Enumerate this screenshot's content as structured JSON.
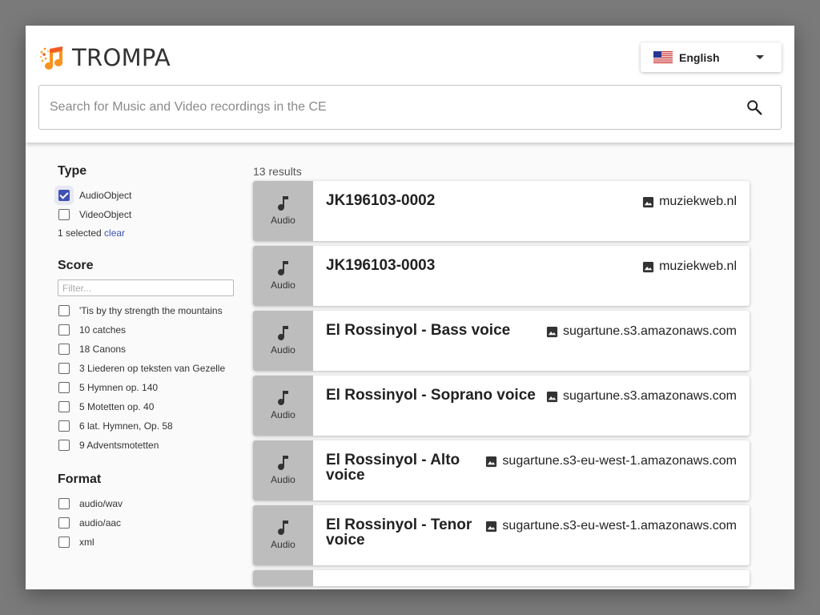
{
  "header": {
    "brand": "TROMPA",
    "language": {
      "label": "English",
      "flag_icon": "us-flag-icon"
    },
    "search": {
      "placeholder": "Search for Music and Video recordings in the CE",
      "value": ""
    }
  },
  "sidebar": {
    "type_facet": {
      "title": "Type",
      "items": [
        {
          "label": "AudioObject",
          "checked": true
        },
        {
          "label": "VideoObject",
          "checked": false
        }
      ],
      "selected_text": "1 selected",
      "clear_label": "clear"
    },
    "score_facet": {
      "title": "Score",
      "filter_placeholder": "Filter...",
      "items": [
        {
          "label": "'Tis by thy strength the mountains",
          "checked": false
        },
        {
          "label": "10 catches",
          "checked": false
        },
        {
          "label": "18 Canons",
          "checked": false
        },
        {
          "label": "3 Liederen op teksten van Gezelle",
          "checked": false
        },
        {
          "label": "5 Hymnen op. 140",
          "checked": false
        },
        {
          "label": "5 Motetten op. 40",
          "checked": false
        },
        {
          "label": "6 lat. Hymnen, Op. 58",
          "checked": false
        },
        {
          "label": "9 Adventsmotetten",
          "checked": false
        }
      ]
    },
    "format_facet": {
      "title": "Format",
      "items": [
        {
          "label": "audio/wav",
          "checked": false
        },
        {
          "label": "audio/aac",
          "checked": false
        },
        {
          "label": "xml",
          "checked": false
        }
      ]
    }
  },
  "results": {
    "count_text": "13 results",
    "items": [
      {
        "type_label": "Audio",
        "title": "JK196103-0002",
        "source": "muziekweb.nl"
      },
      {
        "type_label": "Audio",
        "title": "JK196103-0003",
        "source": "muziekweb.nl"
      },
      {
        "type_label": "Audio",
        "title": "El Rossinyol - Bass voice",
        "source": "sugartune.s3.amazonaws.com"
      },
      {
        "type_label": "Audio",
        "title": "El Rossinyol - Soprano voice",
        "source": "sugartune.s3.amazonaws.com"
      },
      {
        "type_label": "Audio",
        "title": "El Rossinyol - Alto voice",
        "source": "sugartune.s3-eu-west-1.amazonaws.com"
      },
      {
        "type_label": "Audio",
        "title": "El Rossinyol - Tenor voice",
        "source": "sugartune.s3-eu-west-1.amazonaws.com"
      }
    ]
  },
  "colors": {
    "accent": "#3f51b5",
    "thumb_bg": "#bdbdbd",
    "logo_orange": "#f7931e"
  }
}
